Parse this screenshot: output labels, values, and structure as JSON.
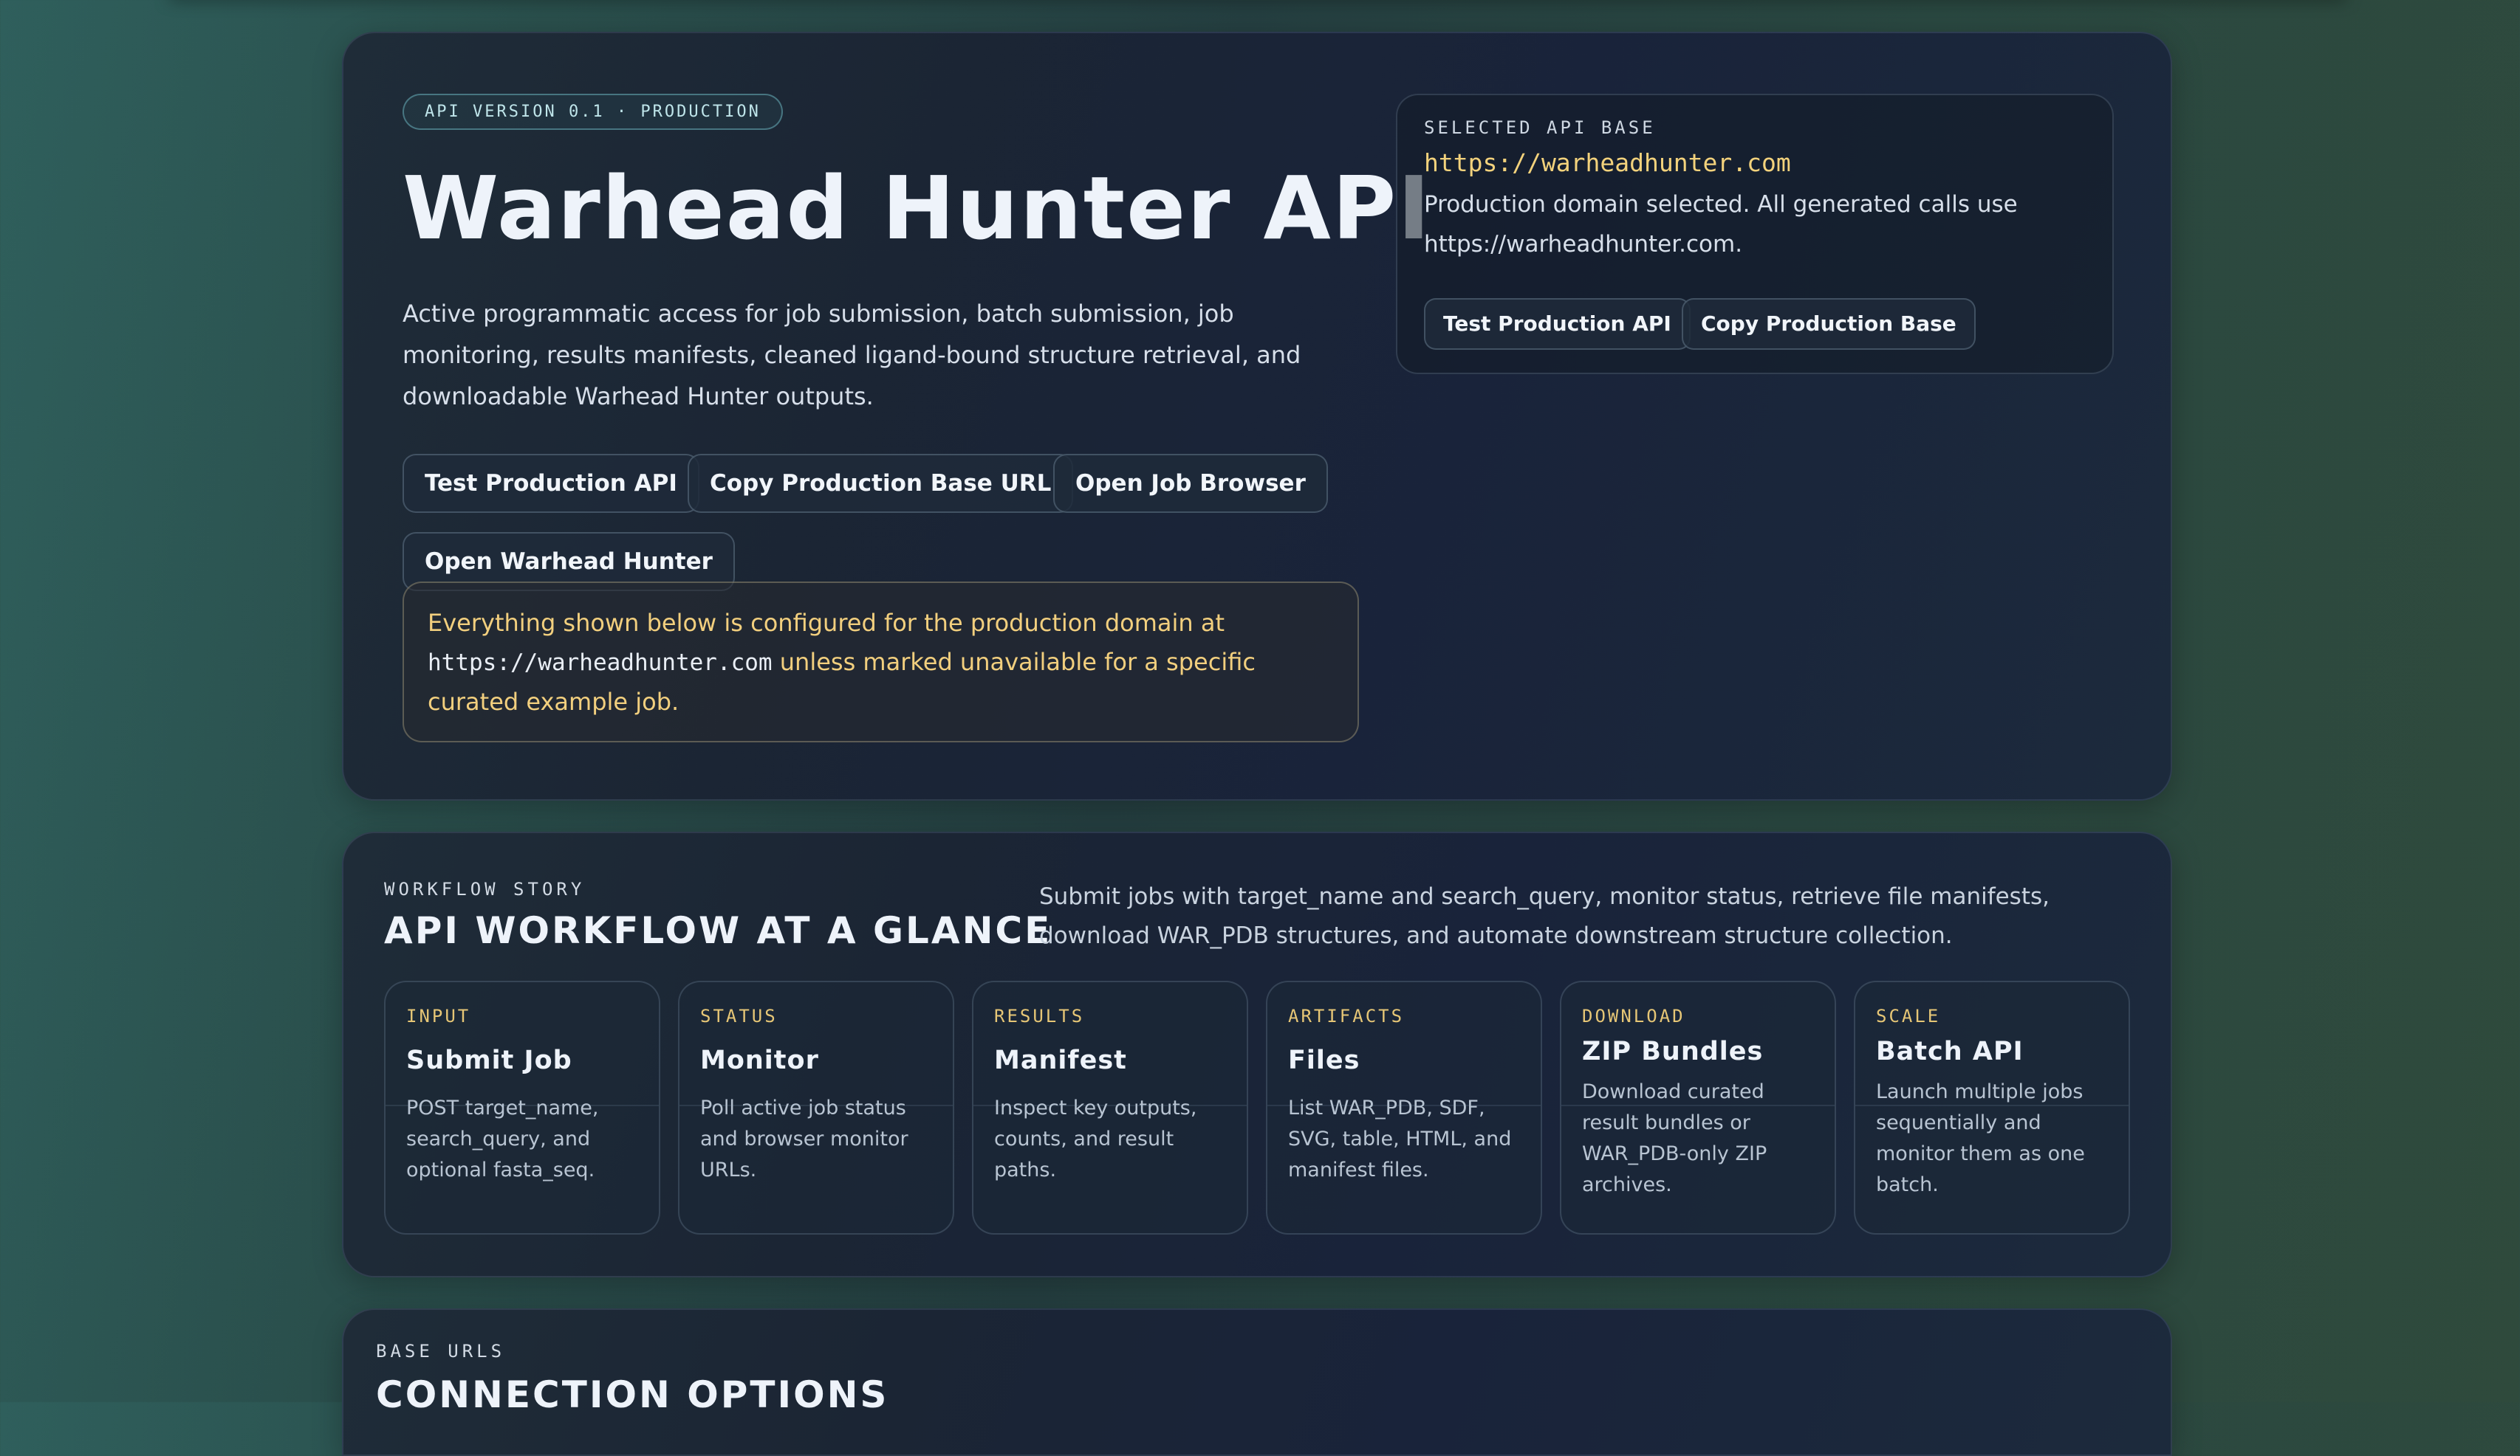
{
  "hero": {
    "version_pill": "API VERSION 0.1 · PRODUCTION",
    "title": "Warhead Hunter API",
    "description": "Active programmatic access for job submission, batch submission, job monitoring, results manifests, cleaned ligand-bound structure retrieval, and downloadable Warhead Hunter outputs.",
    "buttons": {
      "test": "Test Production API",
      "copy_base": "Copy Production Base URL",
      "job_browser": "Open Job Browser",
      "open_app": "Open Warhead Hunter"
    },
    "notice": {
      "before": "Everything shown below is configured for the production domain at",
      "url": "https://warheadhunter.com",
      "after": "unless marked unavailable for a specific curated example job."
    }
  },
  "selected_api": {
    "label": "SELECTED API BASE",
    "url": "https://warheadhunter.com",
    "text": "Production domain selected. All generated calls use https://warheadhunter.com.",
    "test_button": "Test Production API",
    "copy_button": "Copy Production Base"
  },
  "workflow": {
    "eyebrow": "WORKFLOW STORY",
    "title": "API WORKFLOW AT A GLANCE",
    "description": "Submit jobs with target_name and search_query, monitor status, retrieve file manifests, download WAR_PDB structures, and automate downstream structure collection.",
    "steps": [
      {
        "kicker": "INPUT",
        "title": "Submit Job",
        "desc": "POST target_name, search_query, and optional fasta_seq."
      },
      {
        "kicker": "STATUS",
        "title": "Monitor",
        "desc": "Poll active job status and browser monitor URLs."
      },
      {
        "kicker": "RESULTS",
        "title": "Manifest",
        "desc": "Inspect key outputs, counts, and result paths."
      },
      {
        "kicker": "ARTIFACTS",
        "title": "Files",
        "desc": "List WAR_PDB, SDF, SVG, table, HTML, and manifest files."
      },
      {
        "kicker": "DOWNLOAD",
        "title": "ZIP Bundles",
        "desc": "Download curated result bundles or WAR_PDB-only ZIP archives."
      },
      {
        "kicker": "SCALE",
        "title": "Batch API",
        "desc": "Launch multiple jobs sequentially and monitor them as one batch."
      }
    ]
  },
  "base_urls": {
    "eyebrow": "BASE URLS",
    "title": "CONNECTION OPTIONS"
  }
}
